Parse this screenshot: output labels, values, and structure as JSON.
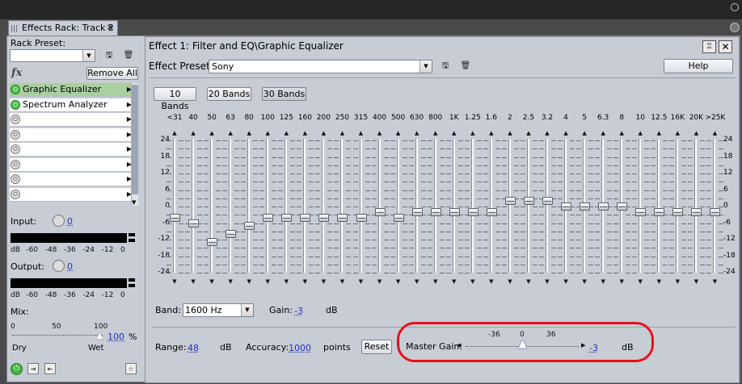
{
  "window": {
    "tab_title": "Effects Rack: Track 2",
    "tab_close": "×"
  },
  "rack": {
    "preset_label": "Rack Preset:",
    "preset_value": "",
    "remove_all": "Remove All",
    "fx_label": "fx",
    "slots": [
      {
        "name": "Graphic Equalizer",
        "on": true,
        "selected": true
      },
      {
        "name": "Spectrum Analyzer",
        "on": true,
        "selected": false
      },
      {
        "name": "",
        "on": false
      },
      {
        "name": "",
        "on": false
      },
      {
        "name": "",
        "on": false
      },
      {
        "name": "",
        "on": false
      },
      {
        "name": "",
        "on": false
      },
      {
        "name": "",
        "on": false
      }
    ],
    "input_label": "Input:",
    "input_value": "0",
    "output_label": "Output:",
    "output_value": "0",
    "meter_ticks": [
      "dB",
      "-60",
      "-48",
      "-36",
      "-24",
      "-12",
      "0"
    ],
    "mix_label": "Mix:",
    "mix_ticks": [
      "0",
      "50",
      "100"
    ],
    "mix_value": "100",
    "mix_unit": "%",
    "dry": "Dry",
    "wet": "Wet"
  },
  "effect": {
    "title": "Effect 1: Filter and EQ\\Graphic Equalizer",
    "preset_label": "Effect Preset:",
    "preset_value": "Sony",
    "help": "Help",
    "band_buttons": [
      "10 Bands",
      "20 Bands",
      "30 Bands"
    ],
    "bands": [
      "<31",
      "40",
      "50",
      "63",
      "80",
      "100",
      "125",
      "160",
      "200",
      "250",
      "315",
      "400",
      "500",
      "630",
      "800",
      "1K",
      "1.25",
      "1.6",
      "2",
      "2.5",
      "3.2",
      "4",
      "5",
      "6.3",
      "8",
      "10",
      "12.5",
      "16K",
      "20K",
      ">25K"
    ],
    "gains": [
      -4,
      -6,
      -13,
      -10,
      -7,
      -4,
      -4,
      -4,
      -4,
      -4,
      -4,
      -2,
      -4,
      -2,
      -2,
      -2,
      -2,
      -2,
      2,
      2,
      2,
      0,
      0,
      0,
      0,
      -2,
      -2,
      -2,
      -2,
      -2
    ],
    "scale": [
      "24",
      "18",
      "12",
      "6",
      "0",
      "-6",
      "-12",
      "-18",
      "-24"
    ],
    "band_label": "Band:",
    "band_value": "1600 Hz",
    "gain_label": "Gain:",
    "gain_value": "-3",
    "gain_unit": "dB",
    "range_label": "Range:",
    "range_value": "48",
    "range_unit": "dB",
    "accuracy_label": "Accuracy:",
    "accuracy_value": "1000",
    "accuracy_unit": "points",
    "reset": "Reset",
    "master_label": "Master Gain:",
    "master_ticks": [
      "-36",
      "0",
      "36"
    ],
    "master_value": "-3",
    "master_unit": "dB",
    "master_gain": -3
  },
  "annotation": {
    "color": "#e8101c"
  }
}
